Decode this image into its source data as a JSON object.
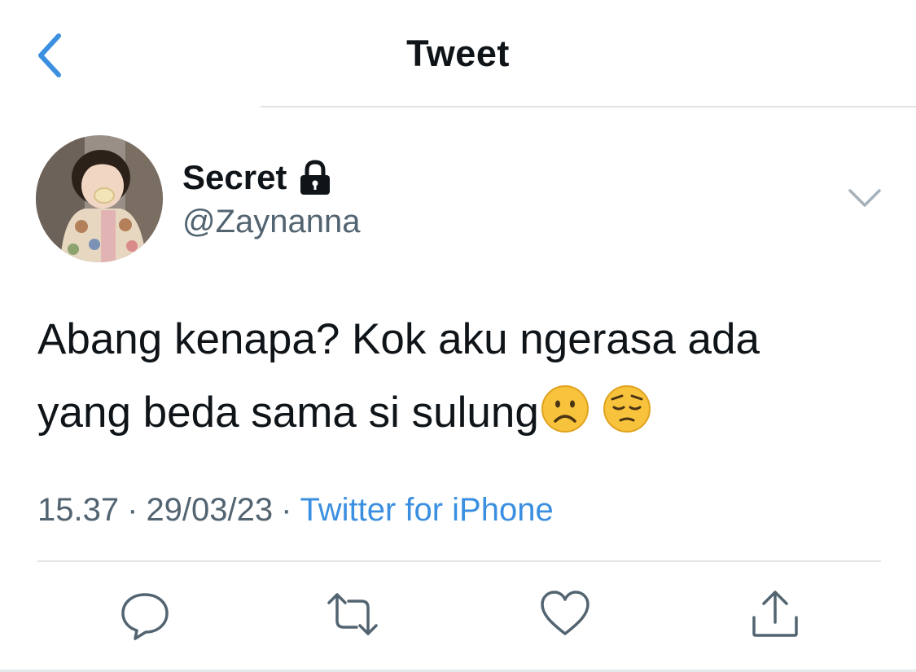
{
  "header": {
    "title": "Tweet",
    "back_icon": "chevron-left-icon"
  },
  "author": {
    "display_name": "Secret",
    "handle": "@Zaynanna",
    "protected_icon": "lock-icon",
    "avatar": "avatar"
  },
  "tweet": {
    "line1": "Abang kenapa? Kok aku ngerasa ada",
    "line2": "yang beda sama si sulung",
    "emojis": [
      "frowning-face-emoji",
      "pensive-face-emoji"
    ]
  },
  "meta": {
    "time": "15.37",
    "separator": "·",
    "date": "29/03/23",
    "source": "Twitter for iPhone"
  },
  "actions": [
    "reply-icon",
    "retweet-icon",
    "like-icon",
    "share-icon"
  ],
  "colors": {
    "accent": "#3b8fe0",
    "text": "#0f1419",
    "secondary": "#536471",
    "divider": "#e1e4e6"
  }
}
